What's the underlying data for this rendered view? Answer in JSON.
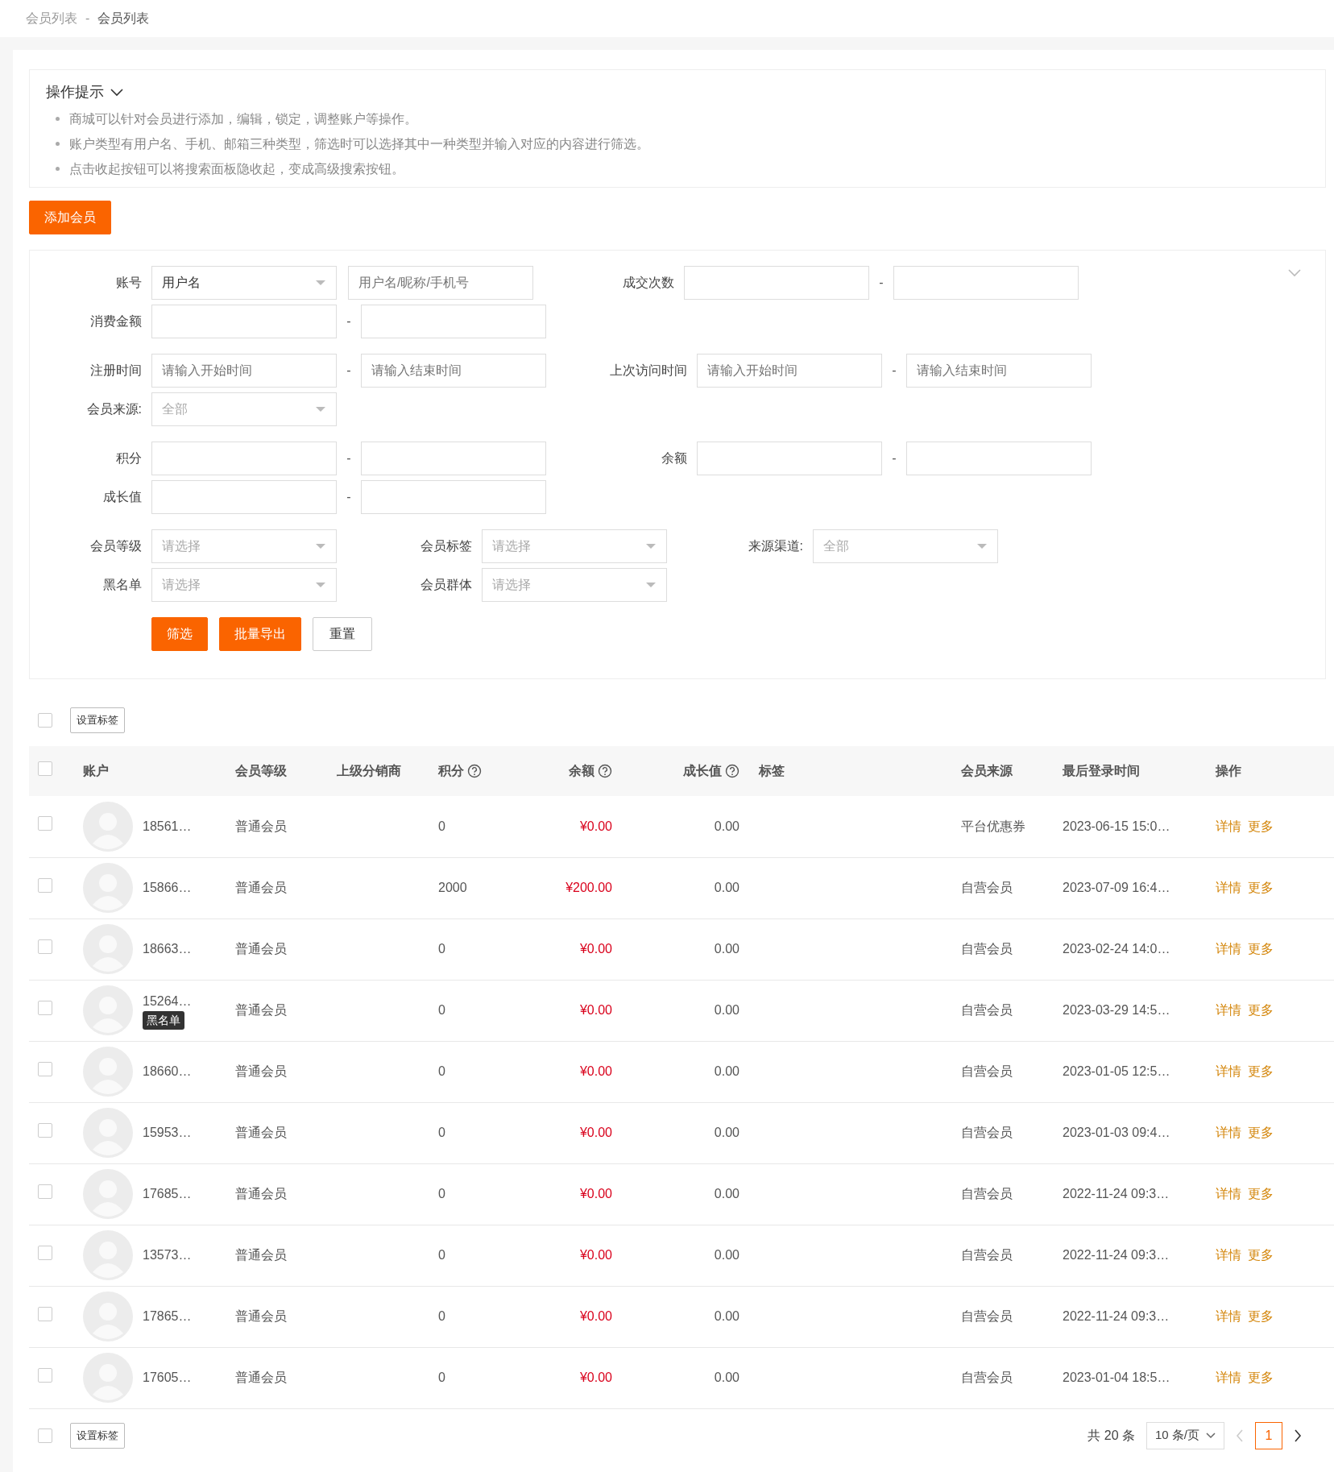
{
  "breadcrumb": {
    "items": [
      "会员列表",
      "会员列表"
    ],
    "separator": "-"
  },
  "tips": {
    "title": "操作提示",
    "expanded": true,
    "items": [
      "商城可以针对会员进行添加，编辑，锁定，调整账户等操作。",
      "账户类型有用户名、手机、邮箱三种类型，筛选时可以选择其中一种类型并输入对应的内容进行筛选。",
      "点击收起按钮可以将搜索面板隐收起，变成高级搜索按钮。"
    ]
  },
  "add_button": "添加会员",
  "filter": {
    "blocks": [
      {
        "rows": [
          {
            "kind": "pair",
            "groups": [
              {
                "label": "账号",
                "controls": [
                  {
                    "kind": "select",
                    "value": "用户名"
                  },
                  {
                    "kind": "input",
                    "placeholder": "用户名/昵称/手机号"
                  }
                ]
              },
              {
                "label": "成交次数",
                "controls": [
                  {
                    "kind": "input"
                  },
                  {
                    "kind": "dash",
                    "text": "-"
                  },
                  {
                    "kind": "input"
                  }
                ]
              }
            ]
          },
          {
            "kind": "pair",
            "groups": [
              {
                "label": "消费金额",
                "controls": [
                  {
                    "kind": "input"
                  },
                  {
                    "kind": "dash",
                    "text": "-"
                  },
                  {
                    "kind": "input"
                  }
                ]
              }
            ]
          }
        ]
      },
      {
        "rows": [
          {
            "kind": "pair",
            "groups": [
              {
                "label": "注册时间",
                "controls": [
                  {
                    "kind": "input",
                    "placeholder": "请输入开始时间"
                  },
                  {
                    "kind": "dash",
                    "text": "-"
                  },
                  {
                    "kind": "input",
                    "placeholder": "请输入结束时间"
                  }
                ]
              },
              {
                "label": "上次访问时间",
                "controls": [
                  {
                    "kind": "input",
                    "placeholder": "请输入开始时间"
                  },
                  {
                    "kind": "dash",
                    "text": "-"
                  },
                  {
                    "kind": "input",
                    "placeholder": "请输入结束时间"
                  }
                ]
              }
            ]
          },
          {
            "kind": "pair",
            "groups": [
              {
                "label": "会员来源:",
                "controls": [
                  {
                    "kind": "select",
                    "placeholder": "全部"
                  }
                ]
              }
            ]
          }
        ]
      },
      {
        "rows": [
          {
            "kind": "pair",
            "groups": [
              {
                "label": "积分",
                "controls": [
                  {
                    "kind": "input"
                  },
                  {
                    "kind": "dash",
                    "text": "-"
                  },
                  {
                    "kind": "input"
                  }
                ]
              },
              {
                "label": "余额",
                "controls": [
                  {
                    "kind": "input"
                  },
                  {
                    "kind": "dash",
                    "text": "-"
                  },
                  {
                    "kind": "input"
                  }
                ]
              }
            ]
          },
          {
            "kind": "pair",
            "groups": [
              {
                "label": "成长值",
                "controls": [
                  {
                    "kind": "input"
                  },
                  {
                    "kind": "dash",
                    "text": "-"
                  },
                  {
                    "kind": "input"
                  }
                ]
              }
            ]
          }
        ]
      },
      {
        "rows": [
          {
            "kind": "triple",
            "groups": [
              {
                "label": "会员等级",
                "controls": [
                  {
                    "kind": "select",
                    "placeholder": "请选择"
                  }
                ]
              },
              {
                "label": "会员标签",
                "controls": [
                  {
                    "kind": "select",
                    "placeholder": "请选择"
                  }
                ]
              },
              {
                "label": "来源渠道:",
                "controls": [
                  {
                    "kind": "select",
                    "placeholder": "全部"
                  }
                ]
              }
            ]
          },
          {
            "kind": "triple",
            "groups": [
              {
                "label": "黑名单",
                "controls": [
                  {
                    "kind": "select",
                    "placeholder": "请选择"
                  }
                ]
              },
              {
                "label": "会员群体",
                "controls": [
                  {
                    "kind": "select",
                    "placeholder": "请选择"
                  }
                ]
              }
            ]
          }
        ]
      }
    ],
    "buttons": [
      {
        "text": "筛选",
        "kind": "primary"
      },
      {
        "text": "批量导出",
        "kind": "primary"
      },
      {
        "text": "重置",
        "kind": "default"
      }
    ]
  },
  "toolbar": {
    "checked": false,
    "button": "设置标签"
  },
  "table": {
    "header_checked": false,
    "columns": [
      {
        "kind": "account",
        "title": "账户"
      },
      {
        "kind": "level",
        "title": "会员等级"
      },
      {
        "kind": "upper",
        "title": "上级分销商"
      },
      {
        "kind": "points",
        "title": "积分",
        "help": true
      },
      {
        "kind": "balance",
        "title": "余额",
        "help": true
      },
      {
        "kind": "growth",
        "title": "成长值",
        "help": true
      },
      {
        "kind": "tag",
        "title": "标签"
      },
      {
        "kind": "source",
        "title": "会员来源"
      },
      {
        "kind": "last_login",
        "title": "最后登录时间"
      },
      {
        "kind": "actions",
        "title": "操作"
      }
    ],
    "rows": [
      {
        "checked": false,
        "account": "18561…",
        "level": "普通会员",
        "points": "0",
        "balance": "¥0.00",
        "growth": "0.00",
        "source": "平台优惠券",
        "last_login": "2023-06-15 15:0…",
        "actions": [
          "详情",
          "更多"
        ]
      },
      {
        "checked": false,
        "account": "15866…",
        "level": "普通会员",
        "points": "2000",
        "balance": "¥200.00",
        "growth": "0.00",
        "source": "自营会员",
        "last_login": "2023-07-09 16:4…",
        "actions": [
          "详情",
          "更多"
        ]
      },
      {
        "checked": false,
        "account": "18663…",
        "level": "普通会员",
        "points": "0",
        "balance": "¥0.00",
        "growth": "0.00",
        "source": "自营会员",
        "last_login": "2023-02-24 14:0…",
        "actions": [
          "详情",
          "更多"
        ]
      },
      {
        "checked": false,
        "account": "15264…",
        "badge": "黑名单",
        "level": "普通会员",
        "points": "0",
        "balance": "¥0.00",
        "growth": "0.00",
        "source": "自营会员",
        "last_login": "2023-03-29 14:5…",
        "actions": [
          "详情",
          "更多"
        ]
      },
      {
        "checked": false,
        "account": "18660…",
        "level": "普通会员",
        "points": "0",
        "balance": "¥0.00",
        "growth": "0.00",
        "source": "自营会员",
        "last_login": "2023-01-05 12:5…",
        "actions": [
          "详情",
          "更多"
        ]
      },
      {
        "checked": false,
        "account": "15953…",
        "level": "普通会员",
        "points": "0",
        "balance": "¥0.00",
        "growth": "0.00",
        "source": "自营会员",
        "last_login": "2023-01-03 09:4…",
        "actions": [
          "详情",
          "更多"
        ]
      },
      {
        "checked": false,
        "account": "17685…",
        "level": "普通会员",
        "points": "0",
        "balance": "¥0.00",
        "growth": "0.00",
        "source": "自营会员",
        "last_login": "2022-11-24 09:3…",
        "actions": [
          "详情",
          "更多"
        ]
      },
      {
        "checked": false,
        "account": "13573…",
        "level": "普通会员",
        "points": "0",
        "balance": "¥0.00",
        "growth": "0.00",
        "source": "自营会员",
        "last_login": "2022-11-24 09:3…",
        "actions": [
          "详情",
          "更多"
        ]
      },
      {
        "checked": false,
        "account": "17865…",
        "level": "普通会员",
        "points": "0",
        "balance": "¥0.00",
        "growth": "0.00",
        "source": "自营会员",
        "last_login": "2022-11-24 09:3…",
        "actions": [
          "详情",
          "更多"
        ]
      },
      {
        "checked": false,
        "account": "17605…",
        "level": "普通会员",
        "points": "0",
        "balance": "¥0.00",
        "growth": "0.00",
        "source": "自营会员",
        "last_login": "2023-01-04 18:5…",
        "actions": [
          "详情",
          "更多"
        ]
      }
    ]
  },
  "footer": {
    "checked": false,
    "button": "设置标签"
  },
  "pagination": {
    "total": "共 20 条",
    "page_size": "10 条/页",
    "pages": [
      {
        "label": "1",
        "selected": true
      }
    ]
  }
}
